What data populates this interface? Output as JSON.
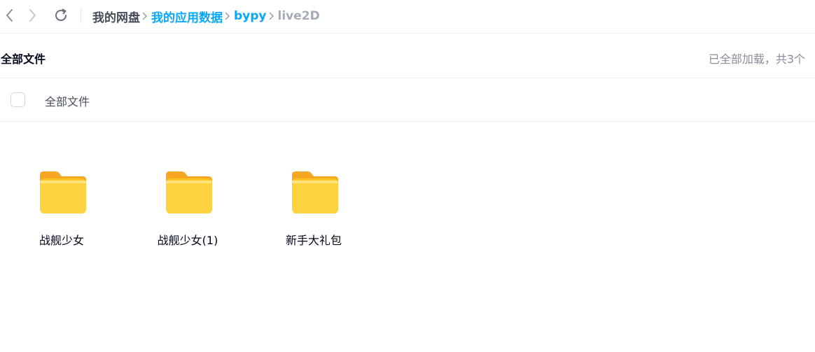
{
  "nav": {
    "back_icon": "chevron-left-icon",
    "forward_icon": "chevron-right-icon",
    "refresh_icon": "refresh-icon"
  },
  "breadcrumb": {
    "items": [
      {
        "label": "我的网盘",
        "state": "root"
      },
      {
        "label": "我的应用数据",
        "state": "link"
      },
      {
        "label": "bypy",
        "state": "link"
      },
      {
        "label": "live2D",
        "state": "current"
      }
    ]
  },
  "header": {
    "title": "全部文件",
    "load_status": "已全部加载，共3个"
  },
  "list_header": {
    "column_label": "全部文件"
  },
  "files": [
    {
      "name": "战舰少女",
      "type": "folder"
    },
    {
      "name": "战舰少女(1)",
      "type": "folder"
    },
    {
      "name": "新手大礼包",
      "type": "folder"
    }
  ],
  "colors": {
    "accent": "#06a7ff",
    "folder": "#ffc51e"
  }
}
